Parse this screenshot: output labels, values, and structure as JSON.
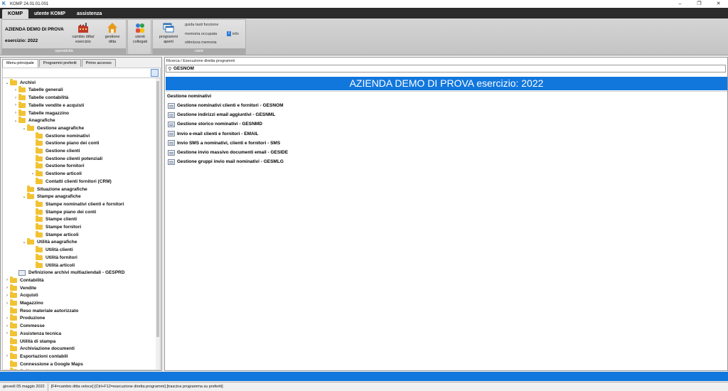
{
  "window": {
    "title": "KOMP 24.01.01.001",
    "icon_glyph": "K",
    "minimize": "–",
    "maximize": "❐",
    "close": "✕"
  },
  "ribbon_tabs": [
    "KOMP",
    "utente KOMP",
    "assistenza"
  ],
  "ribbon": {
    "company": "AZIENDA DEMO DI PROVA",
    "esercizio": "esercizio: 2022",
    "group_operativita": "operatività",
    "cambio_ditta": [
      "cambio ditta/",
      "esercizio"
    ],
    "gestione_ditta": [
      "gestione",
      "ditta"
    ],
    "utenti_collegati": [
      "utenti",
      "collegati"
    ],
    "programmi_aperti": [
      "programmi",
      "aperti"
    ],
    "guida_tasti": "guida tasti funzione",
    "memoria_occupata": "memoria occupata",
    "info": "info",
    "ottimizza_memoria": "ottimizza memoria",
    "group_varie": "varie"
  },
  "left_tabs": [
    "Menu principale",
    "Programmi preferiti",
    "Primo accesso"
  ],
  "tree": [
    {
      "label": "Archivi",
      "level": 0,
      "expand": "open",
      "icon": "folder"
    },
    {
      "label": "Tabelle generali",
      "level": 1,
      "expand": "closed",
      "icon": "folder"
    },
    {
      "label": "Tabelle contabilità",
      "level": 1,
      "expand": "closed",
      "icon": "folder"
    },
    {
      "label": "Tabelle vendite e acquisti",
      "level": 1,
      "expand": "closed",
      "icon": "folder"
    },
    {
      "label": "Tabelle magazzino",
      "level": 1,
      "expand": "closed",
      "icon": "folder"
    },
    {
      "label": "Anagrafiche",
      "level": 1,
      "expand": "open",
      "icon": "folder"
    },
    {
      "label": "Gestione anagrafiche",
      "level": 2,
      "expand": "open",
      "icon": "folder"
    },
    {
      "label": "Gestione nominativi",
      "level": 3,
      "expand": "none",
      "icon": "folder",
      "selected": true
    },
    {
      "label": "Gestione piano dei conti",
      "level": 3,
      "expand": "none",
      "icon": "folder"
    },
    {
      "label": "Gestione clienti",
      "level": 3,
      "expand": "none",
      "icon": "folder"
    },
    {
      "label": "Gestione clienti potenziali",
      "level": 3,
      "expand": "none",
      "icon": "folder"
    },
    {
      "label": "Gestione fornitori",
      "level": 3,
      "expand": "none",
      "icon": "folder"
    },
    {
      "label": "Gestione articoli",
      "level": 3,
      "expand": "closed",
      "icon": "folder"
    },
    {
      "label": "Contatti clienti fornitori (CRM)",
      "level": 3,
      "expand": "none",
      "icon": "folder"
    },
    {
      "label": "Situazione anagrafiche",
      "level": 2,
      "expand": "none",
      "icon": "folder"
    },
    {
      "label": "Stampe anagrafiche",
      "level": 2,
      "expand": "open",
      "icon": "folder"
    },
    {
      "label": "Stampe nominativi clienti e fornitori",
      "level": 3,
      "expand": "none",
      "icon": "folder"
    },
    {
      "label": "Stampe piano dei conti",
      "level": 3,
      "expand": "none",
      "icon": "folder"
    },
    {
      "label": "Stampe clienti",
      "level": 3,
      "expand": "none",
      "icon": "folder"
    },
    {
      "label": "Stampe fornitori",
      "level": 3,
      "expand": "none",
      "icon": "folder"
    },
    {
      "label": "Stampe articoli",
      "level": 3,
      "expand": "none",
      "icon": "folder"
    },
    {
      "label": "Utilità anagrafiche",
      "level": 2,
      "expand": "open",
      "icon": "folder"
    },
    {
      "label": "Utilità clienti",
      "level": 3,
      "expand": "none",
      "icon": "folder"
    },
    {
      "label": "Utilità fornitori",
      "level": 3,
      "expand": "none",
      "icon": "folder"
    },
    {
      "label": "Utilità articoli",
      "level": 3,
      "expand": "none",
      "icon": "folder"
    },
    {
      "label": "Definizione archivi multiaziendali - GESPRD",
      "level": 1,
      "expand": "none",
      "icon": "doc"
    },
    {
      "label": "Contabilità",
      "level": 0,
      "expand": "closed",
      "icon": "folder"
    },
    {
      "label": "Vendite",
      "level": 0,
      "expand": "closed",
      "icon": "folder"
    },
    {
      "label": "Acquisti",
      "level": 0,
      "expand": "closed",
      "icon": "folder"
    },
    {
      "label": "Magazzino",
      "level": 0,
      "expand": "closed",
      "icon": "folder"
    },
    {
      "label": "Reso materiale autorizzato",
      "level": 0,
      "expand": "none",
      "icon": "folder"
    },
    {
      "label": "Produzione",
      "level": 0,
      "expand": "closed",
      "icon": "folder"
    },
    {
      "label": "Commesse",
      "level": 0,
      "expand": "closed",
      "icon": "folder"
    },
    {
      "label": "Assistenza tecnica",
      "level": 0,
      "expand": "closed",
      "icon": "folder"
    },
    {
      "label": "Utilità di stampa",
      "level": 0,
      "expand": "none",
      "icon": "folder"
    },
    {
      "label": "Archiviazione documenti",
      "level": 0,
      "expand": "none",
      "icon": "folder"
    },
    {
      "label": "Esportazioni contabili",
      "level": 0,
      "expand": "closed",
      "icon": "folder"
    },
    {
      "label": "Connessione a Google Maps",
      "level": 0,
      "expand": "none",
      "icon": "folder"
    },
    {
      "label": "Collegamento con ecommerce",
      "level": 0,
      "expand": "none",
      "icon": "folder"
    }
  ],
  "search": {
    "label": "Ricerca / Esecuzione diretta programmi",
    "value": "GESNOM"
  },
  "banner": "AZIENDA DEMO DI PROVA  esercizio: 2022",
  "section_title": "Gestione nominativi",
  "programs": [
    "Gestione nominativi clienti e fornitori - GESNOM",
    "Gestione indirizzi email aggiuntivi - GESNML",
    "Gestione storico nominativi - GESNMD",
    "Invio e-mail clienti e fornitori - EMAIL",
    "Invio SMS a nominativi, clienti e fornitori - SMS",
    "Gestione invio massivo documenti email - GESIDE",
    "Gestione gruppi invio mail nominativi - GESMLG"
  ],
  "status": {
    "date": "giovedì 05 maggio 2022",
    "hint": "[F4=cambio ditta veloce] [Ctrl+F12=esecuzione diretta programmi] [trascina programma su preferiti]"
  }
}
